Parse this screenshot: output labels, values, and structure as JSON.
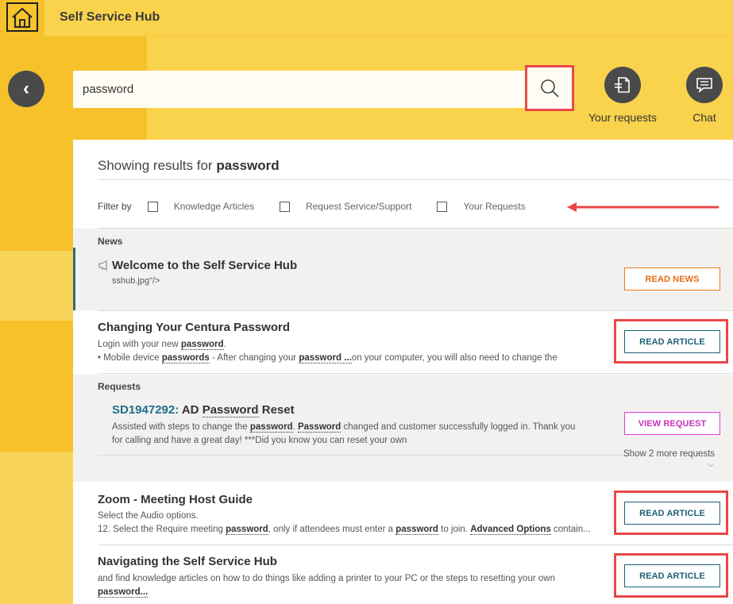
{
  "app": {
    "title": "Self Service Hub"
  },
  "search": {
    "value": "password"
  },
  "header_actions": {
    "requests_label": "Your requests",
    "chat_label": "Chat"
  },
  "results": {
    "prefix": "Showing results for",
    "query": "password"
  },
  "filter": {
    "label": "Filter by",
    "options": [
      "Knowledge Articles",
      "Request Service/Support",
      "Your Requests"
    ]
  },
  "news": {
    "section_label": "News",
    "title": "Welcome to the Self Service Hub",
    "subtitle": "sshub.jpg\"/>",
    "button": "READ NEWS"
  },
  "articles": [
    {
      "title": "Changing Your Centura Password",
      "line1_pre": "Login with your new ",
      "line1_kw": "password",
      "line1_post": ".",
      "line2_pre": "•    Mobile device ",
      "line2_kw1": "passwords",
      "line2_mid": " - After changing your ",
      "line2_kw2": "password ...",
      "line2_post": "on your computer, you will also need to change the",
      "button": "READ ARTICLE"
    },
    {
      "title": "Zoom - Meeting Host Guide",
      "line1": "Select the Audio options.",
      "line2_pre": "12. Select the Require meeting ",
      "line2_kw1": "password",
      "line2_mid": ", only if attendees must enter a ",
      "line2_kw2": "password",
      "line2_mid2": " to join. ",
      "line2_kw3": "Advanced Options",
      "line2_post": " contain...",
      "button": "READ ARTICLE"
    },
    {
      "title": "Navigating the Self Service Hub",
      "line1": "and find knowledge articles on how to do things like adding a printer to your PC or the steps to resetting your own",
      "line2_kw": "password...",
      "button": "READ ARTICLE"
    }
  ],
  "requests": {
    "section_label": "Requests",
    "id": "SD1947292:",
    "title_pre": " AD ",
    "title_kw": "Password",
    "title_post": " Reset",
    "line1_pre": "Assisted with steps to change the ",
    "line1_kw1": "password",
    "line1_mid": ". ",
    "line1_kw2": "Password",
    "line1_post": " changed and customer successfully logged in. Thank you",
    "line2": "for calling and have a great day! ***Did you know you can reset your own",
    "button": "VIEW REQUEST",
    "show_more": "Show 2 more requests"
  }
}
